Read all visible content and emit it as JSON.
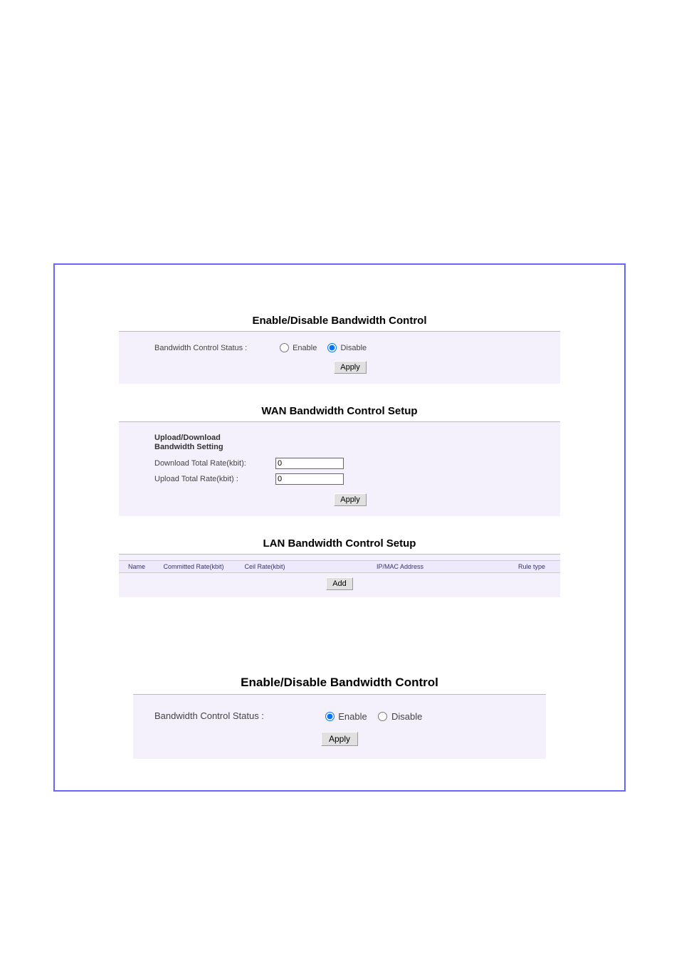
{
  "upper": {
    "section1": {
      "title": "Enable/Disable Bandwidth Control",
      "status_label": "Bandwidth Control Status :",
      "enable_label": "Enable",
      "disable_label": "Disable",
      "apply_label": "Apply"
    },
    "section2": {
      "title": "WAN Bandwidth Control Setup",
      "subheading": "Upload/Download Bandwidth Setting",
      "download_label": "Download Total Rate(kbit):",
      "download_value": "0",
      "upload_label": "Upload Total Rate(kbit) :",
      "upload_value": "0",
      "apply_label": "Apply"
    },
    "section3": {
      "title": "LAN Bandwidth Control Setup",
      "columns": {
        "name": "Name",
        "committed": "Committed Rate(kbit)",
        "ceil": "Ceil Rate(kbit)",
        "ipmac": "IP/MAC Address",
        "ruletype": "Rule type"
      },
      "add_label": "Add"
    }
  },
  "lower": {
    "title": "Enable/Disable Bandwidth Control",
    "status_label": "Bandwidth Control Status :",
    "enable_label": "Enable",
    "disable_label": "Disable",
    "apply_label": "Apply"
  }
}
